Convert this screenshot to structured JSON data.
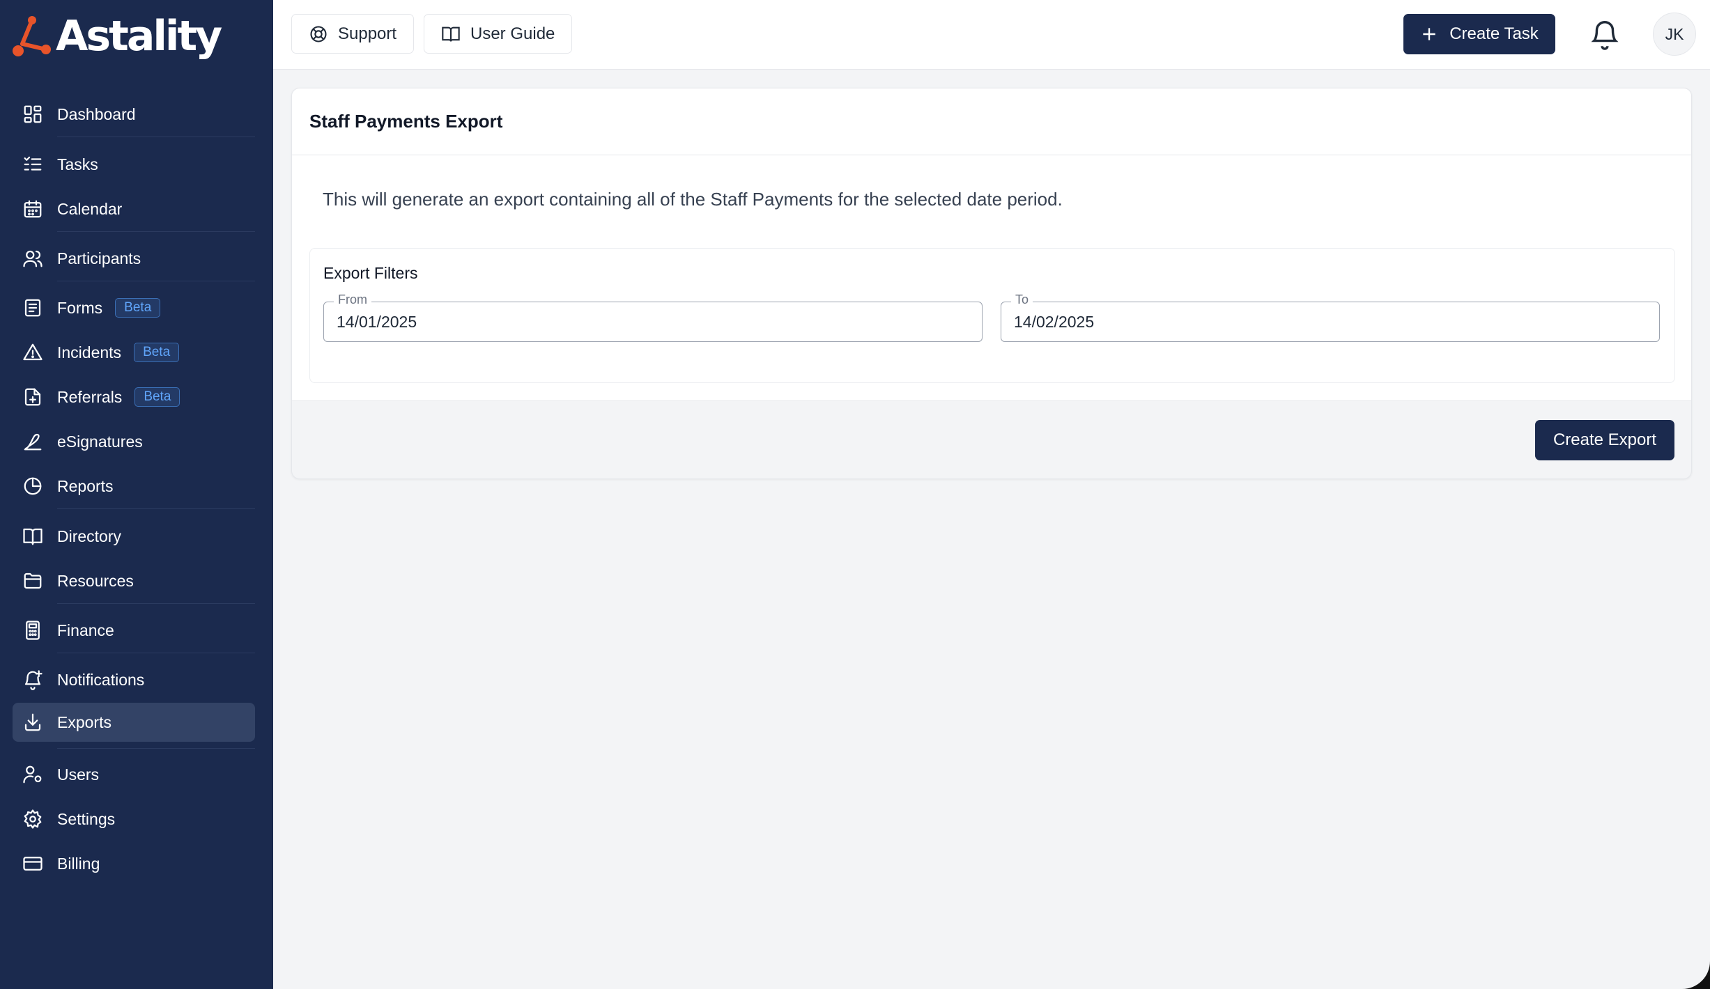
{
  "brand": {
    "name": "Astality"
  },
  "sidebar": {
    "items": [
      {
        "label": "Dashboard",
        "icon": "dashboard-icon"
      },
      {
        "label": "Tasks",
        "icon": "tasks-icon"
      },
      {
        "label": "Calendar",
        "icon": "calendar-icon"
      },
      {
        "label": "Participants",
        "icon": "users-icon"
      },
      {
        "label": "Forms",
        "icon": "forms-icon",
        "badge": "Beta"
      },
      {
        "label": "Incidents",
        "icon": "warning-icon",
        "badge": "Beta"
      },
      {
        "label": "Referrals",
        "icon": "file-plus-icon",
        "badge": "Beta"
      },
      {
        "label": "eSignatures",
        "icon": "signature-icon"
      },
      {
        "label": "Reports",
        "icon": "pie-chart-icon"
      },
      {
        "label": "Directory",
        "icon": "book-icon"
      },
      {
        "label": "Resources",
        "icon": "folder-icon"
      },
      {
        "label": "Finance",
        "icon": "calculator-icon"
      },
      {
        "label": "Notifications",
        "icon": "bell-plus-icon"
      },
      {
        "label": "Exports",
        "icon": "download-icon",
        "active": true
      },
      {
        "label": "Users",
        "icon": "user-gear-icon"
      },
      {
        "label": "Settings",
        "icon": "gear-icon"
      },
      {
        "label": "Billing",
        "icon": "credit-card-icon"
      }
    ]
  },
  "topbar": {
    "support_label": "Support",
    "user_guide_label": "User Guide",
    "create_task_label": "Create Task",
    "avatar_initials": "JK"
  },
  "export": {
    "title": "Staff Payments Export",
    "description": "This will generate an export containing all of the Staff Payments for the selected date period.",
    "filters_title": "Export Filters",
    "from_label": "From",
    "from_value": "14/01/2025",
    "to_label": "To",
    "to_value": "14/02/2025",
    "create_export_label": "Create Export"
  },
  "colors": {
    "sidebar_bg": "#1b2a4e",
    "active_item_bg": "#334366",
    "primary": "#1b2a4e",
    "badge_text": "#60a5fa",
    "logo_accent": "#e8542a"
  }
}
